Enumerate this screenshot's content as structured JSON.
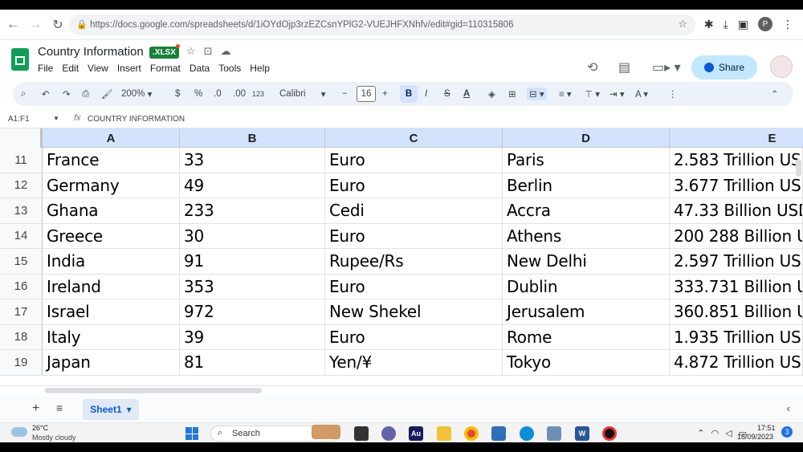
{
  "browser": {
    "url": "https://docs.google.com/spreadsheets/d/1iOYdOjp3rzEZCsnYPlG2-VUEJHFXNhfv/edit#gid=110315806"
  },
  "doc": {
    "title": "Country Information",
    "badge": ".XLSX",
    "menu": [
      "File",
      "Edit",
      "View",
      "Insert",
      "Format",
      "Data",
      "Tools",
      "Help"
    ],
    "share_label": "Share"
  },
  "toolbar": {
    "zoom": "200%",
    "currency": "$",
    "percent": "%",
    "dec_decrease": ".0",
    "dec_increase": ".00",
    "number_format": "123",
    "font": "Calibri",
    "font_size": "16",
    "bold": "B",
    "italic": "I",
    "strike": "S",
    "text_color": "A"
  },
  "formula": {
    "cell_ref": "A1:F1",
    "fx": "fx",
    "value": "COUNTRY INFORMATION"
  },
  "grid": {
    "columns": [
      "A",
      "B",
      "C",
      "D",
      "E"
    ],
    "rows": [
      {
        "num": "11",
        "cells": [
          "France",
          "33",
          "Euro",
          "Paris",
          "2.583 Trillion US"
        ]
      },
      {
        "num": "12",
        "cells": [
          "Germany",
          "49",
          "Euro",
          "Berlin",
          "3.677 Trillion US"
        ]
      },
      {
        "num": "13",
        "cells": [
          "Ghana",
          "233",
          "Cedi",
          "Accra",
          "47.33 Billion USD"
        ]
      },
      {
        "num": "14",
        "cells": [
          "Greece",
          "30",
          "Euro",
          "Athens",
          "200 288 Billion U"
        ]
      },
      {
        "num": "15",
        "cells": [
          "India",
          "91",
          "Rupee/Rs",
          "New Delhi",
          "2.597 Trillion US"
        ]
      },
      {
        "num": "16",
        "cells": [
          "Ireland",
          "353",
          "Euro",
          "Dublin",
          "333.731 Billion U"
        ]
      },
      {
        "num": "17",
        "cells": [
          "Israel",
          "972",
          "New Shekel",
          "Jerusalem",
          "360.851 Billion U"
        ]
      },
      {
        "num": "18",
        "cells": [
          "Italy",
          "39",
          "Euro",
          "Rome",
          "1.935 Trillion US"
        ]
      },
      {
        "num": "19",
        "cells": [
          "Japan",
          "81",
          "Yen/¥",
          "Tokyo",
          "4.872 Trillion US"
        ]
      }
    ]
  },
  "sheets": {
    "active": "Sheet1"
  },
  "taskbar": {
    "temperature": "26°C",
    "weather": "Mostly cloudy",
    "search_label": "Search",
    "time": "17:51",
    "date": "16/09/2023",
    "notifications": "3"
  },
  "colors": {
    "accent": "#0b57d0",
    "header_selected": "#d3e3fd",
    "sheets_green": "#0f9d58"
  }
}
